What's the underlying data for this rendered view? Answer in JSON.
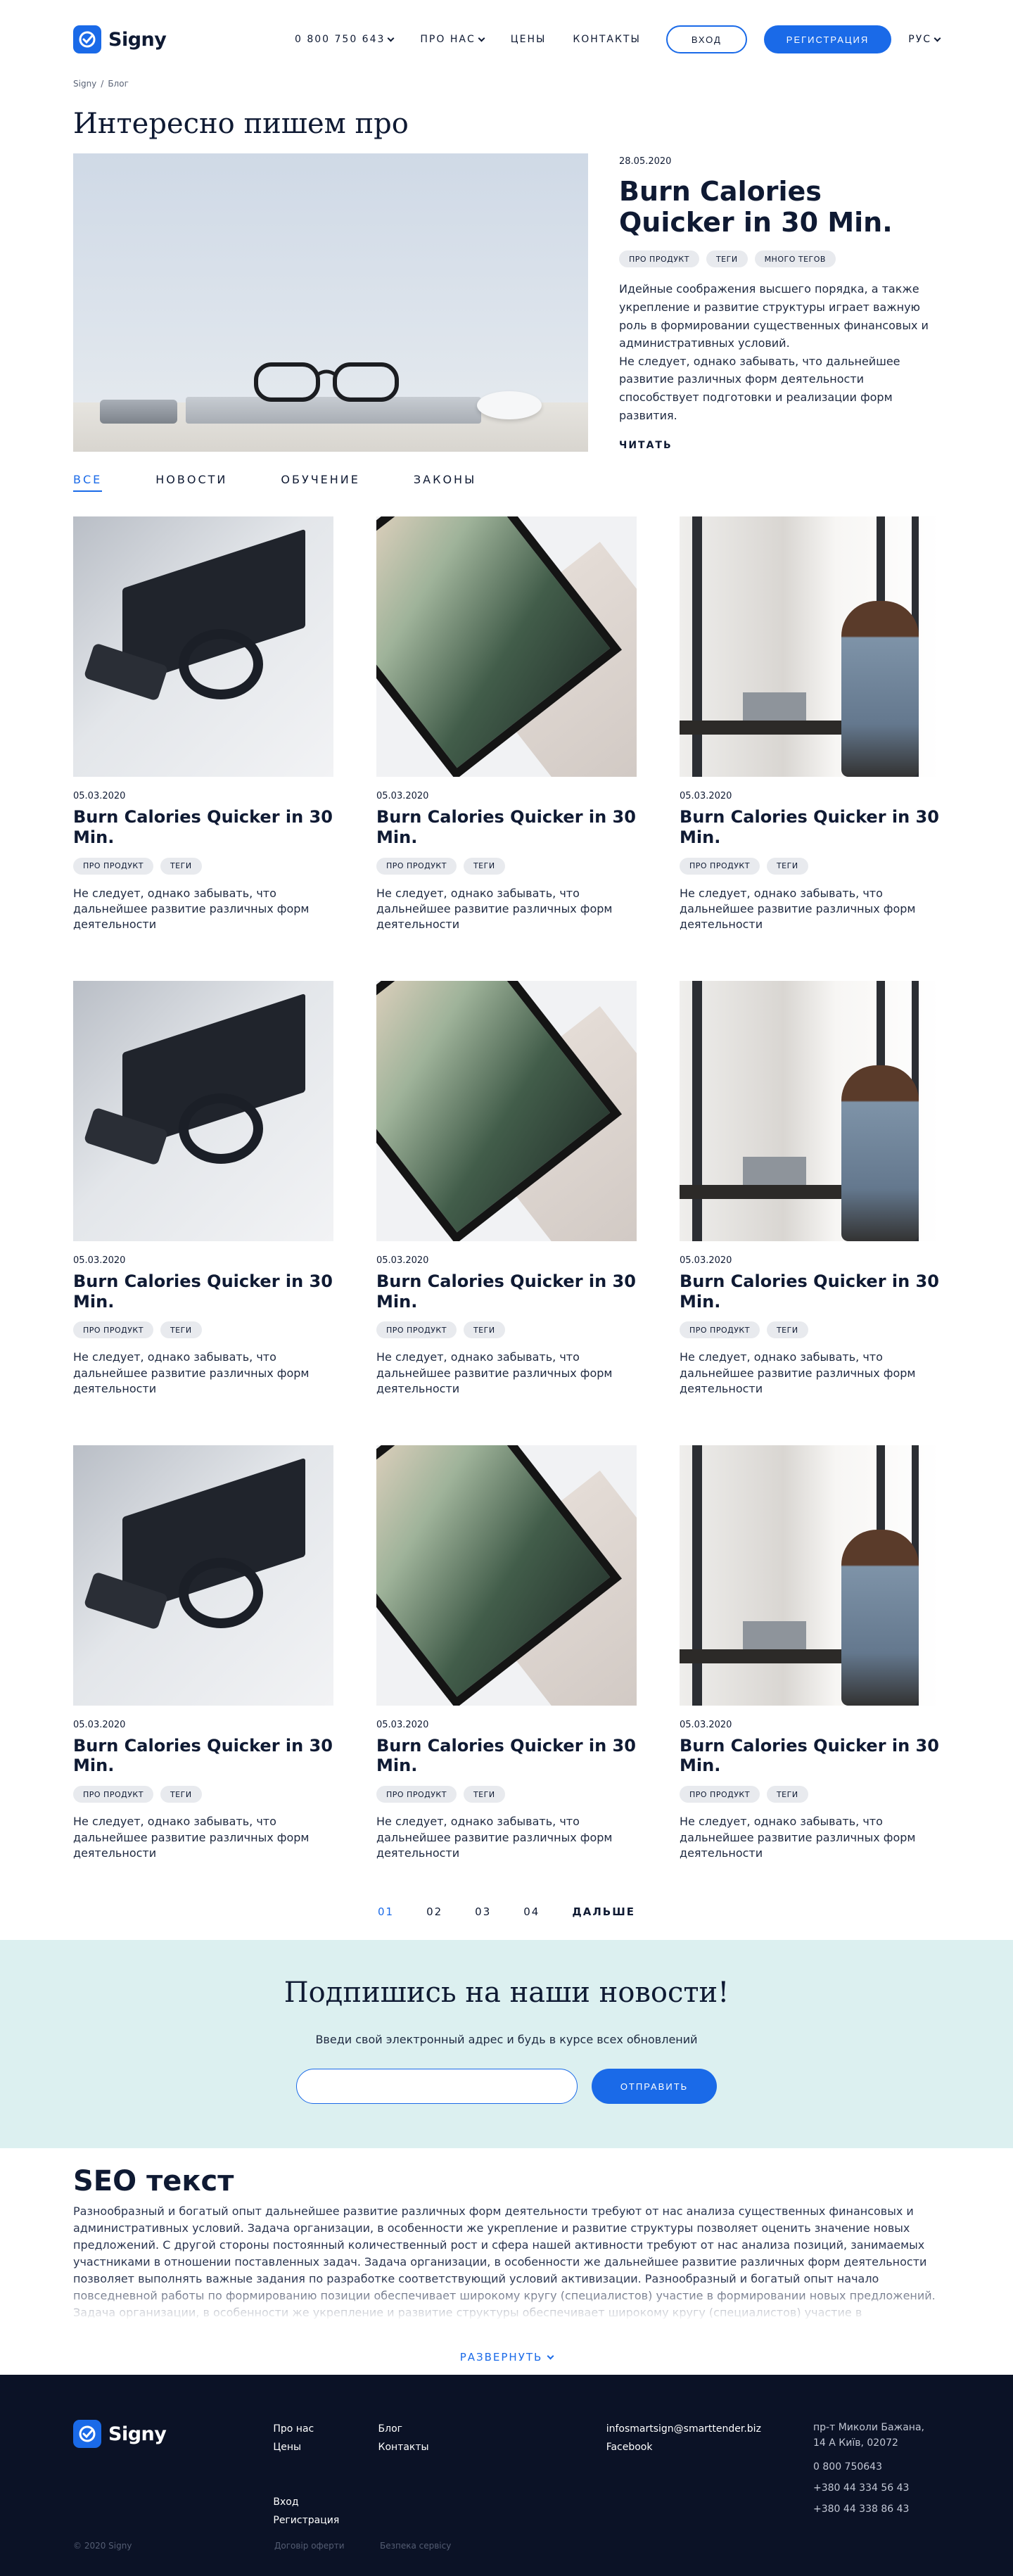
{
  "header": {
    "logo_text": "Signy",
    "phone": "0 800 750 643",
    "nav_about": "ПРО НАС",
    "nav_prices": "ЦЕНЫ",
    "nav_contacts": "КОНТАКТЫ",
    "login": "ВХОД",
    "register": "РЕГИСТРАЦИЯ",
    "lang": "РУС"
  },
  "breadcrumb": {
    "home": "Signy",
    "sep": "/",
    "current": "Блог"
  },
  "page_title": "Интересно пишем про",
  "featured": {
    "date": "28.05.2020",
    "title": "Burn Calories Quicker in 30 Min.",
    "tags": [
      "ПРО ПРОДУКТ",
      "ТЕГИ",
      "МНОГО ТЕГОВ"
    ],
    "text1": "Идейные соображения высшего порядка, а также укрепление и развитие структуры играет важную роль в формировании существенных финансовых и административных условий.",
    "text2": "Не следует, однако забывать, что дальнейшее развитие различных форм деятельности способствует подготовки и реализации форм развития.",
    "read": "ЧИТАТЬ"
  },
  "filters": [
    "ВСЕ",
    "НОВОСТИ",
    "ОБУЧЕНИЕ",
    "ЗАКОНЫ"
  ],
  "posts": [
    {
      "image": "headphones",
      "date": "05.03.2020",
      "title": "Burn Calories Quicker in 30 Min.",
      "tags": [
        "ПРО ПРОДУКТ",
        "ТЕГИ"
      ],
      "text": "Не следует, однако забывать, что дальнейшее развитие различных форм деятельности"
    },
    {
      "image": "laptop",
      "date": "05.03.2020",
      "title": "Burn Calories Quicker in 30 Min.",
      "tags": [
        "ПРО ПРОДУКТ",
        "ТЕГИ"
      ],
      "text": "Не следует, однако забывать, что дальнейшее развитие различных форм деятельности"
    },
    {
      "image": "woman",
      "date": "05.03.2020",
      "title": "Burn Calories Quicker in 30 Min.",
      "tags": [
        "ПРО ПРОДУКТ",
        "ТЕГИ"
      ],
      "text": "Не следует, однако забывать, что дальнейшее развитие различных форм деятельности"
    },
    {
      "image": "headphones",
      "date": "05.03.2020",
      "title": "Burn Calories Quicker in 30 Min.",
      "tags": [
        "ПРО ПРОДУКТ",
        "ТЕГИ"
      ],
      "text": "Не следует, однако забывать, что дальнейшее развитие различных форм деятельности"
    },
    {
      "image": "laptop",
      "date": "05.03.2020",
      "title": "Burn Calories Quicker in 30 Min.",
      "tags": [
        "ПРО ПРОДУКТ",
        "ТЕГИ"
      ],
      "text": "Не следует, однако забывать, что дальнейшее развитие различных форм деятельности"
    },
    {
      "image": "woman",
      "date": "05.03.2020",
      "title": "Burn Calories Quicker in 30 Min.",
      "tags": [
        "ПРО ПРОДУКТ",
        "ТЕГИ"
      ],
      "text": "Не следует, однако забывать, что дальнейшее развитие различных форм деятельности"
    },
    {
      "image": "headphones",
      "date": "05.03.2020",
      "title": "Burn Calories Quicker in 30 Min.",
      "tags": [
        "ПРО ПРОДУКТ",
        "ТЕГИ"
      ],
      "text": "Не следует, однако забывать, что дальнейшее развитие различных форм деятельности"
    },
    {
      "image": "laptop",
      "date": "05.03.2020",
      "title": "Burn Calories Quicker in 30 Min.",
      "tags": [
        "ПРО ПРОДУКТ",
        "ТЕГИ"
      ],
      "text": "Не следует, однако забывать, что дальнейшее развитие различных форм деятельности"
    },
    {
      "image": "woman",
      "date": "05.03.2020",
      "title": "Burn Calories Quicker in 30 Min.",
      "tags": [
        "ПРО ПРОДУКТ",
        "ТЕГИ"
      ],
      "text": "Не следует, однако забывать, что дальнейшее развитие различных форм деятельности"
    }
  ],
  "pagination": {
    "pages": [
      "01",
      "02",
      "03",
      "04"
    ],
    "active": "01",
    "next": "ДАЛЬШЕ"
  },
  "subscribe": {
    "title": "Подпишись на наши новости!",
    "text": "Введи свой электронный адрес и будь в курсе всех обновлений",
    "input_value": "",
    "button": "ОТПРАВИТЬ"
  },
  "seo": {
    "title": "SEO текст",
    "text": "Разнообразный и богатый опыт дальнейшее развитие различных форм деятельности требуют от нас анализа существенных финансовых и административных условий. Задача организации, в особенности же укрепление и развитие структуры позволяет оценить значение новых предложений. С другой стороны постоянный количественный рост и сфера нашей активности требуют от нас анализа позиций, занимаемых участниками в отношении поставленных задач. Задача организации, в особенности же дальнейшее развитие различных форм деятельности позволяет выполнять важные задания по разработке соответствующий условий активизации. Разнообразный и богатый опыт начало повседневной работы по формированию позиции обеспечивает широкому кругу (специалистов) участие в формировании новых предложений. Задача организации, в особенности же укрепление и развитие структуры обеспечивает широкому кругу (специалистов) участие в",
    "expand": "РАЗВЕРНУТЬ"
  },
  "footer": {
    "logo_text": "Signy",
    "col1": [
      "Про нас",
      "Цены"
    ],
    "col1b": [
      "Вход",
      "Регистрация"
    ],
    "col2": [
      "Блог",
      "Контакты"
    ],
    "email": "infosmartsign@smarttender.biz",
    "facebook": "Facebook",
    "address": "пр-т Миколи Бажана, 14 А Київ, 02072",
    "phones": [
      "0 800 750643",
      "+380 44 334 56 43",
      "+380 44 338 86 43"
    ],
    "copyright": "© 2020 Signy",
    "offer": "Договір оферти",
    "security": "Безпека сервісу"
  },
  "colors": {
    "accent": "#1a6ae8",
    "footer_bg": "#0b1226",
    "subscribe_bg": "#dcf0f0"
  }
}
